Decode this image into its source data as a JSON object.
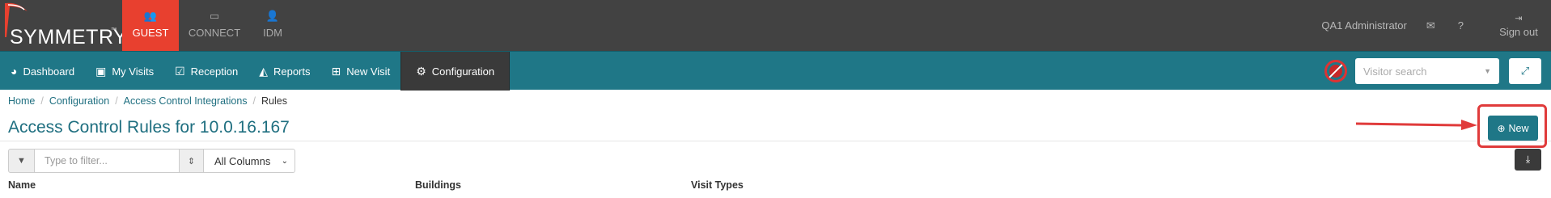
{
  "header": {
    "logo_text": "SYMMETRY",
    "logo_tm": "™",
    "apps": [
      {
        "label": "GUEST",
        "icon": "people-icon",
        "glyph": "👥"
      },
      {
        "label": "CONNECT",
        "icon": "card-icon",
        "glyph": "▭"
      },
      {
        "label": "IDM",
        "icon": "user-plus-icon",
        "glyph": "👤"
      }
    ],
    "user_name": "QA1 Administrator",
    "mail_icon": "✉",
    "help_icon": "?",
    "signout_label": "Sign out",
    "signout_icon": "⇥"
  },
  "nav": {
    "items": [
      {
        "label": "Dashboard",
        "icon": "dashboard-icon",
        "glyph": "◕"
      },
      {
        "label": "My Visits",
        "icon": "calendar-icon",
        "glyph": "▣"
      },
      {
        "label": "Reception",
        "icon": "checkbox-icon",
        "glyph": "☑"
      },
      {
        "label": "Reports",
        "icon": "area-chart-icon",
        "glyph": "◭"
      },
      {
        "label": "New Visit",
        "icon": "calendar-plus-icon",
        "glyph": "⊞"
      },
      {
        "label": "Configuration",
        "icon": "gear-icon",
        "glyph": "⚙"
      }
    ],
    "visitor_search_placeholder": "Visitor search",
    "expand_icon": "⤢"
  },
  "breadcrumb": {
    "items": [
      "Home",
      "Configuration",
      "Access Control Integrations"
    ],
    "current": "Rules",
    "separator": "/"
  },
  "page": {
    "title": "Access Control Rules for 10.0.16.167",
    "new_button_label": "New",
    "new_button_icon": "⊕"
  },
  "filter": {
    "placeholder": "Type to filter...",
    "columns_selected": "All Columns",
    "filter_icon": "▼",
    "sort_icon": "⇕",
    "download_icon": "⤓"
  },
  "table": {
    "columns": [
      "Name",
      "Buildings",
      "Visit Types"
    ]
  },
  "colors": {
    "topbar": "#424242",
    "navbar": "#1f7787",
    "active_app": "#e8402f",
    "annotation": "#e03b3b"
  }
}
